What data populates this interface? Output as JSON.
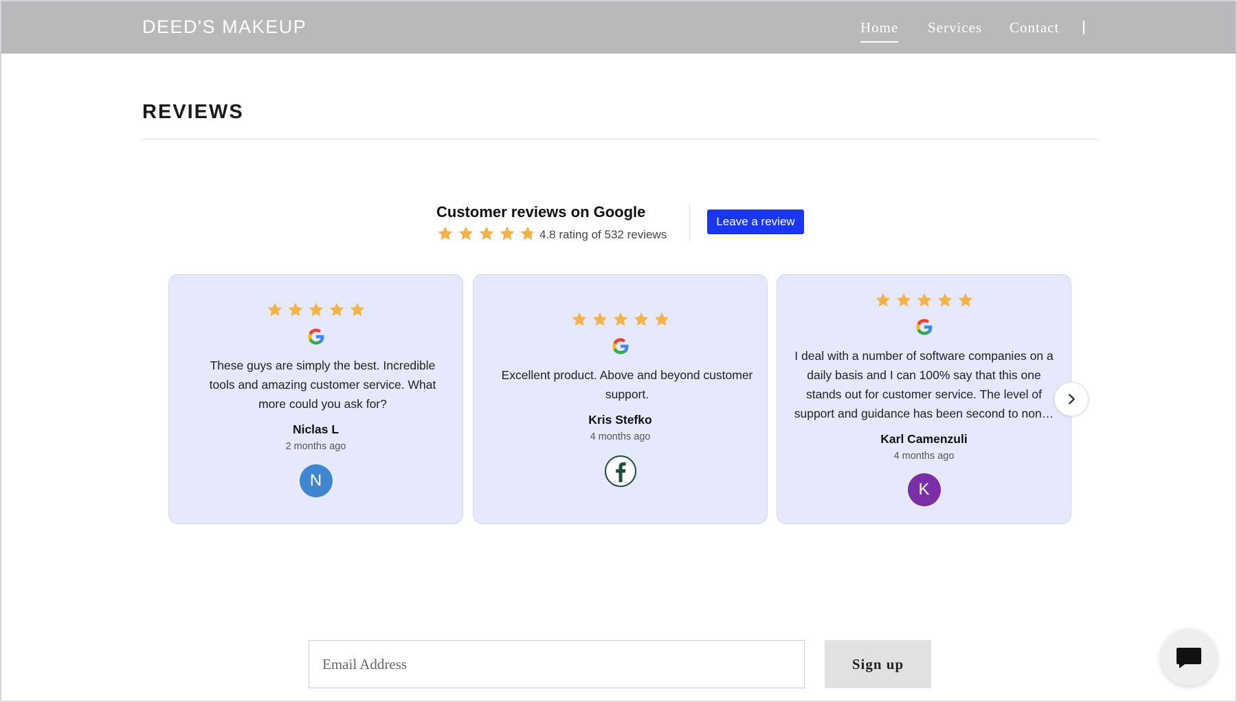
{
  "header": {
    "brand": "DEED'S MAKEUP",
    "nav": [
      {
        "label": "Home",
        "active": true
      },
      {
        "label": "Services",
        "active": false
      },
      {
        "label": "Contact",
        "active": false
      }
    ]
  },
  "section": {
    "title": "REVIEWS"
  },
  "summary": {
    "title": "Customer reviews on Google",
    "rating_text": "4.8 rating of 532 reviews",
    "rating_value": 4.8,
    "button_label": "Leave a review"
  },
  "reviews": [
    {
      "stars": 5,
      "source_icon": "google-icon",
      "text": "These guys are simply the best. Incredible tools and amazing customer service. What more could you ask for?",
      "author": "Niclas L",
      "time": "2 months ago",
      "avatar_initial": "N",
      "avatar_color": "#3f86d0"
    },
    {
      "stars": 5,
      "source_icon": "google-icon",
      "text": "Excellent product. Above and beyond customer support.",
      "author": "Kris Stefko",
      "time": "4 months ago",
      "avatar_icon": "facebook-icon"
    },
    {
      "stars": 5,
      "source_icon": "google-icon",
      "text": "I deal with a number of software companies on a daily basis and I can 100% say that this one stands out for customer service. The level of support and guidance has been second to non…",
      "author": "Karl Camenzuli",
      "time": "4 months ago",
      "avatar_initial": "K",
      "avatar_color": "#7b2fa6"
    }
  ],
  "newsletter": {
    "placeholder": "Email Address",
    "value": "",
    "button_label": "Sign up"
  },
  "icons": {
    "next": "chevron-right-icon",
    "chat": "chat-icon",
    "star": "star-icon"
  },
  "colors": {
    "header_bg": "#b8b9ba",
    "card_bg": "#e6e9fb",
    "star": "#f2b34b",
    "primary_button": "#1a36f0"
  }
}
